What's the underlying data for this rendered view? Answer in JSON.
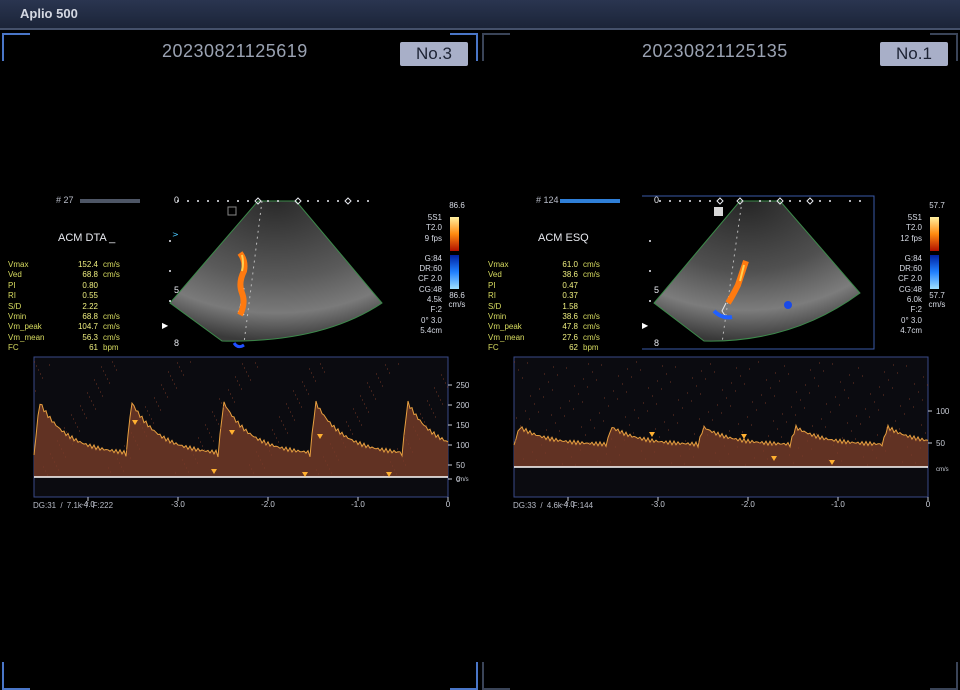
{
  "app": {
    "title": "Aplio 500"
  },
  "panels": [
    {
      "study_id": "20230821125619",
      "number": "No.3",
      "clip_number": "# 27",
      "vessel": "ACM DTA _",
      "measurements": [
        {
          "label": "Vmax",
          "value": "152.4",
          "unit": "cm/s"
        },
        {
          "label": "Ved",
          "value": "68.8",
          "unit": "cm/s"
        },
        {
          "label": "PI",
          "value": "0.80",
          "unit": ""
        },
        {
          "label": "RI",
          "value": "0.55",
          "unit": ""
        },
        {
          "label": "S/D",
          "value": "2.22",
          "unit": ""
        },
        {
          "label": "Vmin",
          "value": "68.8",
          "unit": "cm/s"
        },
        {
          "label": "Vm_peak",
          "value": "104.7",
          "unit": "cm/s"
        },
        {
          "label": "Vm_mean",
          "value": "56.3",
          "unit": "cm/s"
        },
        {
          "label": "FC",
          "value": "61",
          "unit": "bpm"
        }
      ],
      "depth_marks": [
        "0",
        "5",
        "8"
      ],
      "params": [
        "5S1",
        "T2.0",
        "9 fps",
        "",
        "G:84",
        "DR:60",
        "CF 2.0",
        "CG:48",
        "4.5k",
        "F:2",
        "0°  3.0",
        "5.4cm"
      ],
      "colorbar": {
        "top": "86.6",
        "bottom": "86.6",
        "unit": "cm/s"
      },
      "spectrum": {
        "y_ticks": [
          "250",
          "200",
          "150",
          "100",
          "50",
          "0"
        ],
        "y_unit": "cm/s",
        "x_ticks": [
          "-4.0",
          "-3.0",
          "-2.0",
          "-1.0",
          "0"
        ],
        "footer": "DG:31   / 7.1k    / F:222"
      }
    },
    {
      "study_id": "20230821125135",
      "number": "No.1",
      "clip_number": "# 124",
      "vessel": "ACM ESQ",
      "measurements": [
        {
          "label": "Vmax",
          "value": "61.0",
          "unit": "cm/s"
        },
        {
          "label": "Ved",
          "value": "38.6",
          "unit": "cm/s"
        },
        {
          "label": "PI",
          "value": "0.47",
          "unit": ""
        },
        {
          "label": "RI",
          "value": "0.37",
          "unit": ""
        },
        {
          "label": "S/D",
          "value": "1.58",
          "unit": ""
        },
        {
          "label": "Vmin",
          "value": "38.6",
          "unit": "cm/s"
        },
        {
          "label": "Vm_peak",
          "value": "47.8",
          "unit": "cm/s"
        },
        {
          "label": "Vm_mean",
          "value": "27.6",
          "unit": "cm/s"
        },
        {
          "label": "FC",
          "value": "62",
          "unit": "bpm"
        }
      ],
      "depth_marks": [
        "0",
        "5",
        "8"
      ],
      "params": [
        "5S1",
        "T2.0",
        "12 fps",
        "",
        "G:84",
        "DR:60",
        "CF 2.0",
        "CG:48",
        "6.0k",
        "F:2",
        "0°  3.0",
        "4.7cm"
      ],
      "colorbar": {
        "top": "57.7",
        "bottom": "57.7",
        "unit": "cm/s"
      },
      "spectrum": {
        "y_ticks": [
          "100",
          "50"
        ],
        "y_unit": "cm/s",
        "x_ticks": [
          "-4.0",
          "-3.0",
          "-2.0",
          "-1.0",
          "0"
        ],
        "footer": "DG:33   / 4.6k    / F:144"
      }
    }
  ],
  "colors": {
    "accent": "#4a76c8",
    "measurement": "#f0f080",
    "doppler_trace": "#e8a040"
  }
}
